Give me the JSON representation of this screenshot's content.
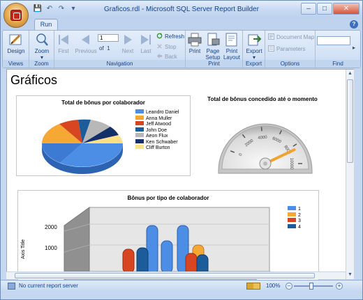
{
  "window": {
    "title": "Graficos.rdl - Microsoft SQL Server Report Builder",
    "tab": "Run"
  },
  "ribbon": {
    "views": {
      "label": "Views",
      "design": "Design"
    },
    "zoom": {
      "label": "Zoom",
      "zoom": "Zoom"
    },
    "navigation": {
      "label": "Navigation",
      "first": "First",
      "previous": "Previous",
      "page_value": "1",
      "of_label": "of",
      "total_pages": "1",
      "next": "Next",
      "last": "Last",
      "refresh": "Refresh",
      "stop": "Stop",
      "back": "Back"
    },
    "print": {
      "label": "Print",
      "print": "Print",
      "page_setup": "Page Setup",
      "print_layout": "Print Layout"
    },
    "export": {
      "label": "Export",
      "export": "Export"
    },
    "options": {
      "label": "Options",
      "document_map": "Document Map",
      "parameters": "Parameters"
    },
    "find": {
      "label": "Find"
    }
  },
  "report": {
    "title": "Gráficos",
    "pie_chart": {
      "title": "Total de bônus por colaborador",
      "legend": [
        {
          "name": "Leandro Daniel",
          "color": "#4c8ee6"
        },
        {
          "name": "Anna Muller",
          "color": "#f6a834"
        },
        {
          "name": "Jeff Atwood",
          "color": "#d84521"
        },
        {
          "name": "John Doe",
          "color": "#1c5c9a"
        },
        {
          "name": "Aeon Flux",
          "color": "#b8b8b8"
        },
        {
          "name": "Ken Schwaber",
          "color": "#13306b"
        },
        {
          "name": "Cliff Burton",
          "color": "#fde086"
        }
      ]
    },
    "gauge": {
      "title": "Total de bônus concedido até o momento",
      "ticks": [
        "0",
        "2000",
        "4000",
        "6000",
        "8000",
        "10000"
      ],
      "needle_fraction": 0.84
    },
    "bar3d": {
      "title": "Bônus por tipo de colaborador",
      "y_axis_title": "Axis Title",
      "y_ticks": [
        "2000",
        "1000"
      ],
      "legend": [
        {
          "name": "1",
          "color": "#4c8ee6"
        },
        {
          "name": "2",
          "color": "#f6a834"
        },
        {
          "name": "3",
          "color": "#d84521"
        },
        {
          "name": "4",
          "color": "#1c5c9a"
        }
      ]
    }
  },
  "statusbar": {
    "text": "No current report server",
    "zoom": "100%"
  }
}
